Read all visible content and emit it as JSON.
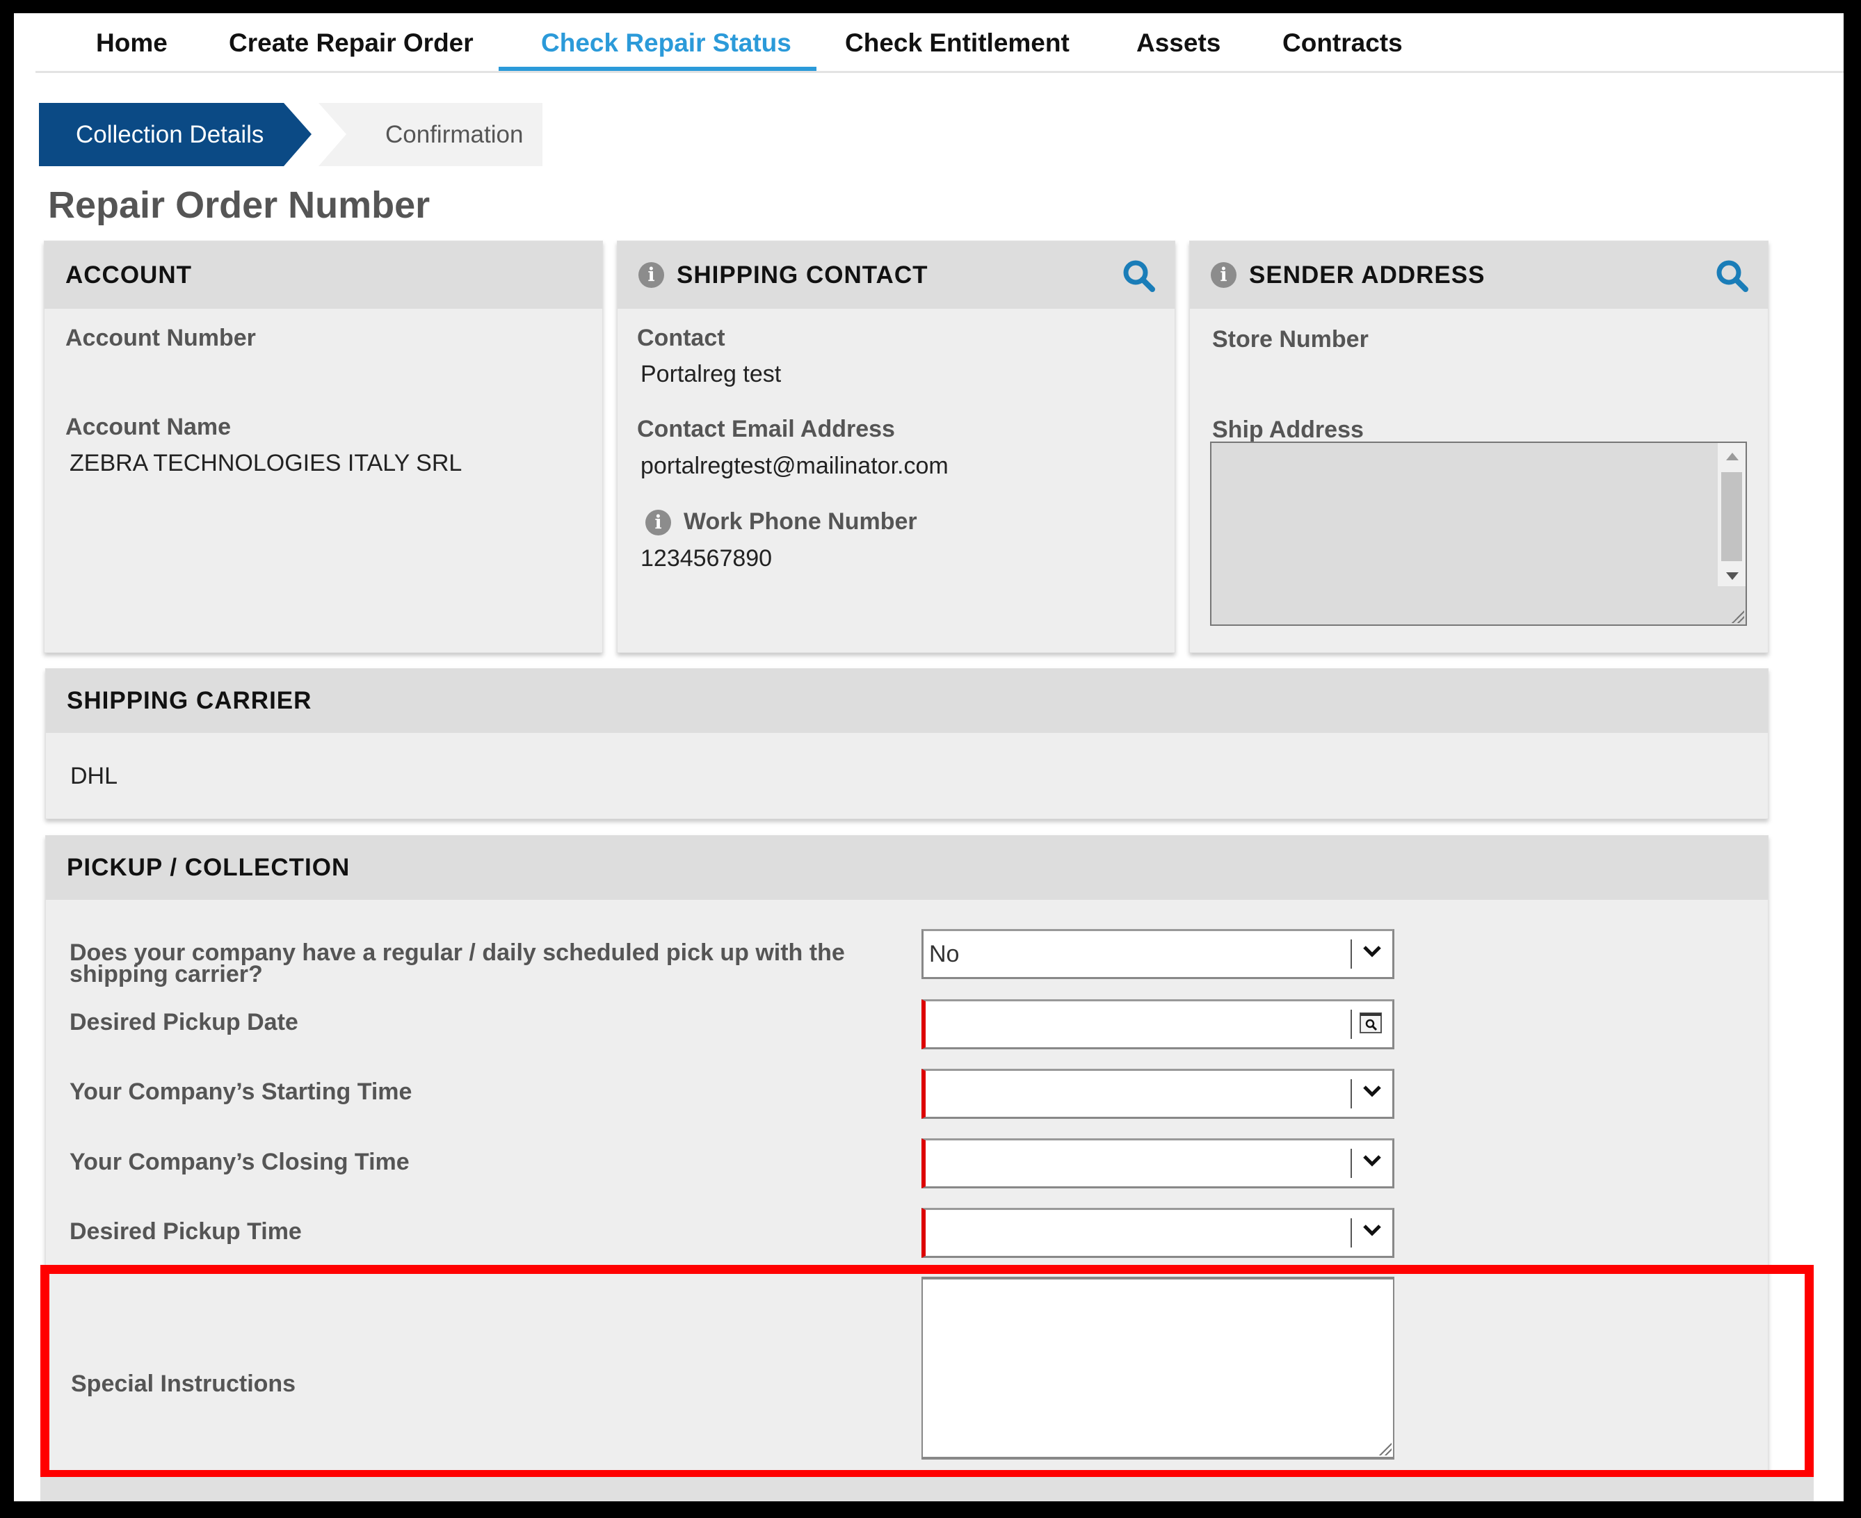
{
  "nav": {
    "items": [
      {
        "label": "Home",
        "active": false
      },
      {
        "label": "Create Repair Order",
        "active": false
      },
      {
        "label": "Check Repair Status",
        "active": true
      },
      {
        "label": "Check Entitlement",
        "active": false
      },
      {
        "label": "Assets",
        "active": false
      },
      {
        "label": "Contracts",
        "active": false
      }
    ],
    "accent_color": "#2b9ad9"
  },
  "steps": [
    {
      "label": "Collection Details",
      "active": true
    },
    {
      "label": "Confirmation",
      "active": false
    }
  ],
  "page_title": "Repair Order Number",
  "account": {
    "title": "ACCOUNT",
    "account_number_label": "Account Number",
    "account_number_value": "",
    "account_name_label": "Account Name",
    "account_name_value": "ZEBRA TECHNOLOGIES ITALY SRL"
  },
  "shipping_contact": {
    "title": "SHIPPING CONTACT",
    "info_icon": "info-icon",
    "search_icon": "search-icon",
    "contact_label": "Contact",
    "contact_value": "Portalreg test",
    "email_label": "Contact Email Address",
    "email_value": "portalregtest@mailinator.com",
    "phone_label": "Work Phone Number",
    "phone_value": "1234567890"
  },
  "sender_address": {
    "title": "SENDER ADDRESS",
    "info_icon": "info-icon",
    "search_icon": "search-icon",
    "store_number_label": "Store Number",
    "store_number_value": "",
    "ship_address_label": "Ship Address",
    "ship_address_value": ""
  },
  "shipping_carrier": {
    "title": "SHIPPING CARRIER",
    "value": "DHL"
  },
  "pickup": {
    "title": "PICKUP / COLLECTION",
    "fields": [
      {
        "label_line1": "Does your company have a regular / daily scheduled pick up with the",
        "label_line2": "shipping carrier?",
        "value": "No",
        "type": "select",
        "required": false
      },
      {
        "label": "Desired Pickup Date",
        "value": "",
        "type": "date",
        "required": true
      },
      {
        "label": "Your Company’s Starting Time",
        "value": "",
        "type": "select",
        "required": true
      },
      {
        "label": "Your Company’s Closing Time",
        "value": "",
        "type": "select",
        "required": true
      },
      {
        "label": "Desired Pickup Time",
        "value": "",
        "type": "select",
        "required": true
      }
    ],
    "special_instructions_label": "Special Instructions",
    "special_instructions_value": ""
  },
  "colors": {
    "step_active": "#0b4a85",
    "search_icon": "#1a7db8",
    "required_marker": "#dd0000",
    "highlight_box": "#ff0000"
  }
}
